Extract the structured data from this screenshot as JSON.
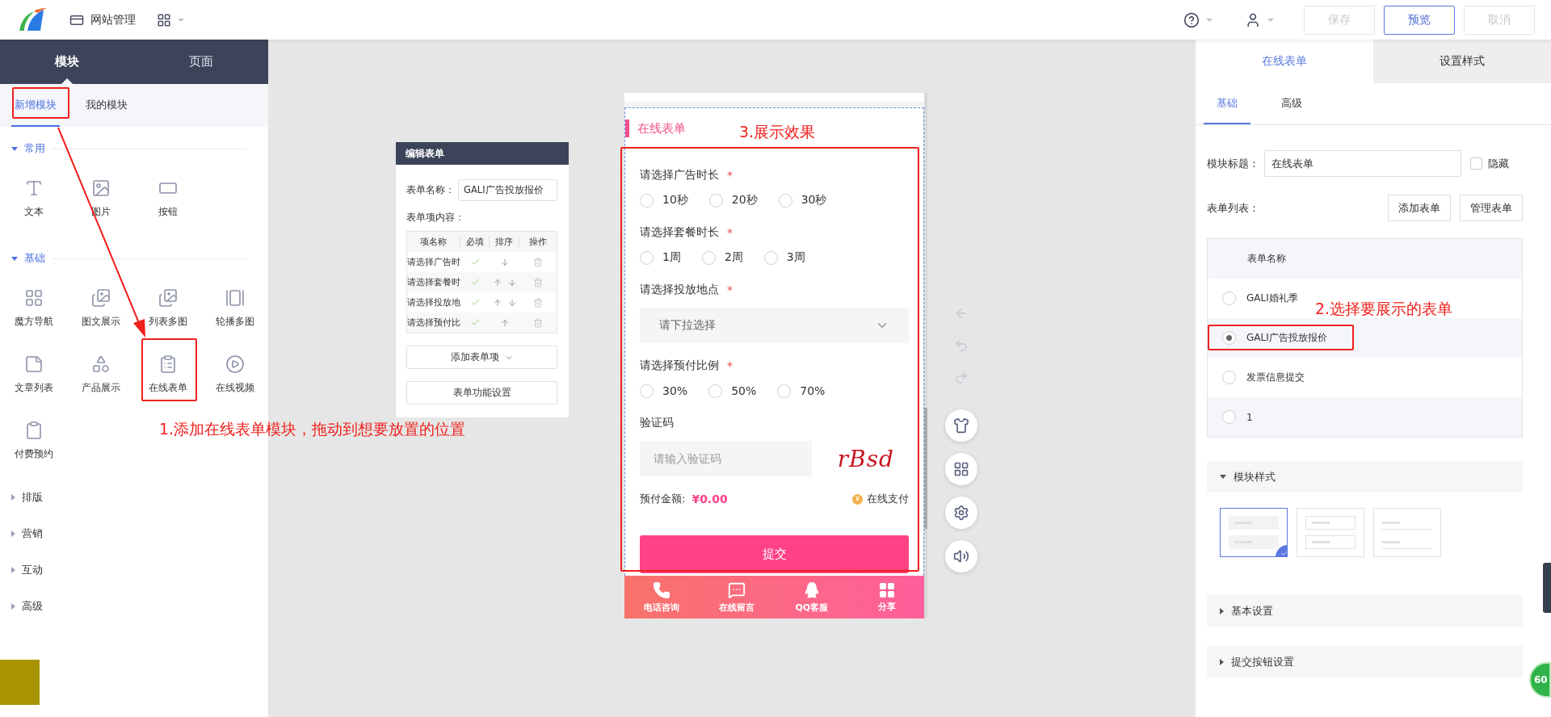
{
  "topbar": {
    "site_menu": "网站管理",
    "actions": [
      {
        "label": "保存",
        "kind": "disabled"
      },
      {
        "label": "预览",
        "kind": "primary"
      },
      {
        "label": "取消",
        "kind": "disabled"
      }
    ]
  },
  "sidebar": {
    "tabs": [
      {
        "label": "模块",
        "selected": true
      },
      {
        "label": "页面",
        "selected": false
      }
    ],
    "subtabs": [
      {
        "label": "新增模块",
        "selected": true
      },
      {
        "label": "我的模块",
        "selected": false
      }
    ],
    "groups": [
      {
        "label": "常用",
        "expanded": true,
        "items": [
          {
            "label": "文本",
            "kind": "text"
          },
          {
            "label": "图片",
            "kind": "image"
          },
          {
            "label": "按钮",
            "kind": "button"
          }
        ]
      },
      {
        "label": "基础",
        "expanded": true,
        "items": [
          {
            "label": "魔方导航",
            "kind": "grid"
          },
          {
            "label": "图文展示",
            "kind": "imagetext"
          },
          {
            "label": "列表多图",
            "kind": "images"
          },
          {
            "label": "轮播多图",
            "kind": "carousel"
          },
          {
            "label": "文章列表",
            "kind": "article"
          },
          {
            "label": "产品展示",
            "kind": "product"
          },
          {
            "label": "在线表单",
            "kind": "form"
          },
          {
            "label": "在线视频",
            "kind": "video"
          },
          {
            "label": "付费预约",
            "kind": "booking"
          }
        ]
      },
      {
        "label": "排版",
        "expanded": false
      },
      {
        "label": "营销",
        "expanded": false
      },
      {
        "label": "互动",
        "expanded": false
      },
      {
        "label": "高级",
        "expanded": false
      }
    ]
  },
  "editor": {
    "title": "编辑表单",
    "name_label": "表单名称：",
    "name_value": "GALI广告投放报价",
    "items_label": "表单项内容：",
    "columns": [
      "项名称",
      "必填",
      "排序",
      "操作"
    ],
    "rows": [
      {
        "name": "请选择广告时",
        "required": true,
        "move_up": false,
        "move_down": true
      },
      {
        "name": "请选择套餐时",
        "required": true,
        "move_up": true,
        "move_down": true
      },
      {
        "name": "请选择投放地",
        "required": true,
        "move_up": true,
        "move_down": true
      },
      {
        "name": "请选择预付比",
        "required": true,
        "move_up": true,
        "move_down": false
      }
    ],
    "buttons": [
      "添加表单项",
      "表单功能设置"
    ]
  },
  "phone": {
    "module_title": "在线表单",
    "fields": [
      {
        "kind": "radio",
        "label": "请选择广告时长",
        "mark": "*",
        "options": [
          {
            "label": "10秒",
            "selected": false
          },
          {
            "label": "20秒",
            "selected": false
          },
          {
            "label": "30秒",
            "selected": false
          }
        ]
      },
      {
        "kind": "radio",
        "label": "请选择套餐时长",
        "mark": "*",
        "options": [
          {
            "label": "1周",
            "selected": false
          },
          {
            "label": "2周",
            "selected": false
          },
          {
            "label": "3周",
            "selected": false
          }
        ]
      },
      {
        "kind": "select",
        "label": "请选择投放地点",
        "mark": "*",
        "placeholder": "请下拉选择"
      },
      {
        "kind": "radio",
        "label": "请选择预付比例",
        "mark": "*",
        "options": [
          {
            "label": "30%",
            "selected": false
          },
          {
            "label": "50%",
            "selected": false
          },
          {
            "label": "70%",
            "selected": false
          }
        ]
      },
      {
        "kind": "captcha",
        "label": "验证码",
        "placeholder": "请输入验证码",
        "code": "rBsd"
      }
    ],
    "amount_label": "预付金额:",
    "amount": "¥0.00",
    "payment": "在线支付",
    "payment_badge": "¥",
    "submit": "提交",
    "bottom_nav": [
      {
        "label": "电话咨询",
        "kind": "phone"
      },
      {
        "label": "在线留言",
        "kind": "message"
      },
      {
        "label": "QQ客服",
        "kind": "qq"
      },
      {
        "label": "分享",
        "kind": "share"
      }
    ]
  },
  "settings": {
    "tabs": [
      {
        "label": "在线表单",
        "selected": true
      },
      {
        "label": "设置样式",
        "selected": false
      }
    ],
    "subtabs": [
      {
        "label": "基础",
        "selected": true
      },
      {
        "label": "高级",
        "selected": false
      }
    ],
    "title_label": "模块标题：",
    "title_value": "在线表单",
    "hide": {
      "label": "隐藏",
      "checked": false
    },
    "list_label": "表单列表：",
    "list_buttons": [
      "添加表单",
      "管理表单"
    ],
    "table_header": "表单名称",
    "forms": [
      {
        "name": "GALI婚礼季",
        "selected": false
      },
      {
        "name": "GALI广告投放报价",
        "selected": true
      },
      {
        "name": "发票信息提交",
        "selected": false
      },
      {
        "name": "1",
        "selected": false
      }
    ],
    "sections": [
      {
        "label": "模块样式",
        "expanded": true
      },
      {
        "label": "基本设置",
        "expanded": false
      },
      {
        "label": "提交按钮设置",
        "expanded": false
      }
    ],
    "styles": [
      {
        "kind": "filled",
        "selected": true
      },
      {
        "kind": "outlined",
        "selected": false
      },
      {
        "kind": "underlined",
        "selected": false
      }
    ]
  },
  "annotations": [
    "1.添加在线表单模块，拖动到想要放置的位置",
    "2.选择要展示的表单",
    "3.展示效果"
  ],
  "badge": "60"
}
